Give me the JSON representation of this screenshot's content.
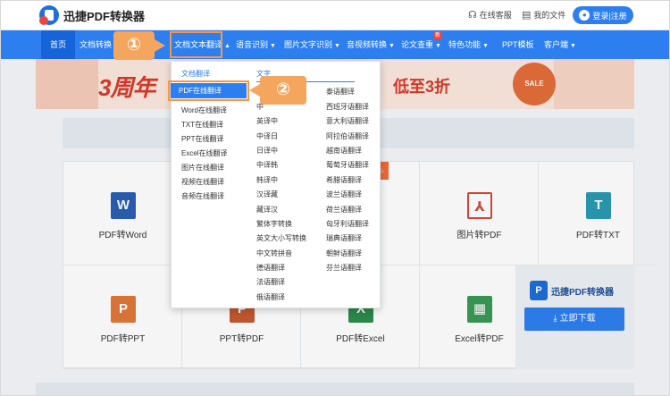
{
  "header": {
    "logo_text": "迅捷PDF转换器",
    "online_service": "在线客服",
    "my_files": "我的文件",
    "login": "登录|注册"
  },
  "nav": {
    "home": "首页",
    "doc_convert": "文档转换",
    "doc_translate": "文档文本翻译",
    "speech": "语音识别",
    "image_ocr": "图片文字识别",
    "av_convert": "音视频转换",
    "paper_check": "论文查重",
    "new_badge": "新",
    "special": "特色功能",
    "ppt_template": "PPT模板",
    "client": "客户端"
  },
  "banner": {
    "left_text": "3周年",
    "right_text": "低至3折",
    "sale": "SALE"
  },
  "dropdown": {
    "col1_title": "文档翻译",
    "col2_title": "文字",
    "col1": [
      "PDF在线翻译",
      "Word在线翻译",
      "TXT在线翻译",
      "PPT在线翻译",
      "Excel在线翻译",
      "图片在线翻译",
      "视频在线翻译",
      "音频在线翻译"
    ],
    "col2": [
      "中",
      "英译中",
      "中译日",
      "日译中",
      "中译韩",
      "韩译中",
      "汉译藏",
      "藏译汉",
      "繁体字转换",
      "英文大小写转换",
      "中文转拼音",
      "德语翻译",
      "法语翻译",
      "俄语翻译"
    ],
    "col3": [
      "泰语翻译",
      "西班牙语翻译",
      "意大利语翻译",
      "阿拉伯语翻译",
      "越南语翻译",
      "葡萄牙语翻译",
      "希腊语翻译",
      "波兰语翻译",
      "荷兰语翻译",
      "匈牙利语翻译",
      "瑞典语翻译",
      "朝鲜语翻译",
      "芬兰语翻译"
    ]
  },
  "grid": {
    "pdf_word": "PDF转Word",
    "img_pdf": "图片转PDF",
    "pdf_txt": "PDF转TXT",
    "pdf_ppt": "PDF转PPT",
    "ppt_pdf": "PPT转PDF",
    "pdf_excel": "PDF转Excel",
    "excel_pdf": "Excel转PDF"
  },
  "promo": {
    "title": "迅捷PDF转换器",
    "download": "立即下载"
  },
  "callouts": {
    "one": "①",
    "two": "②"
  },
  "colors": {
    "primary": "#2d7ff0",
    "callout": "#f4a55e"
  }
}
